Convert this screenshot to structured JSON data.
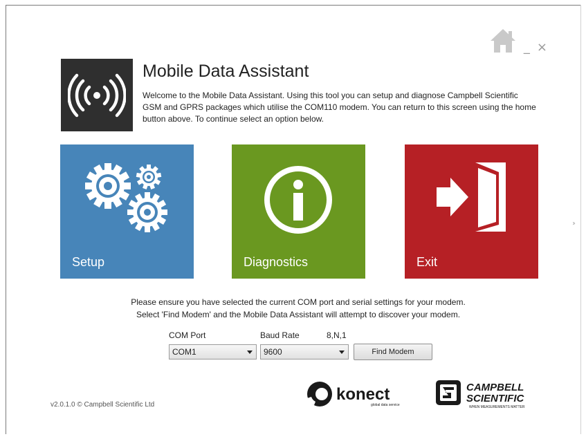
{
  "app": {
    "title": "Mobile Data Assistant",
    "welcome_text": "Welcome to the Mobile Data Assistant.  Using this tool you can setup and diagnose Campbell Scientific GSM and GPRS packages which utilise the COM110 modem.  You can return to this screen using the home button above.  To continue select an option below."
  },
  "window_controls": {
    "minimize": "_",
    "close": "×"
  },
  "tiles": [
    {
      "label": "Setup",
      "icon": "gears-icon",
      "color": "#4785b9"
    },
    {
      "label": "Diagnostics",
      "icon": "info-icon",
      "color": "#6a9820"
    },
    {
      "label": "Exit",
      "icon": "exit-door-icon",
      "color": "#b62025"
    }
  ],
  "next_arrow": "››",
  "instructions": {
    "line1": "Please ensure you have selected the current COM port and serial settings for your modem.",
    "line2": "Select 'Find Modem' and the Mobile Data Assistant will attempt to discover your modem."
  },
  "settings": {
    "com_port_label": "COM Port",
    "com_port_value": "COM1",
    "baud_rate_label": "Baud Rate",
    "baud_rate_value": "9600",
    "serial_format": "8,N,1",
    "find_button_label": "Find Modem"
  },
  "footer": {
    "version": "v2.0.1.0 © Campbell Scientific Ltd",
    "konect_name": "konect",
    "konect_tagline": "global data service",
    "campbell_line1": "CAMPBELL",
    "campbell_line2": "SCIENTIFIC",
    "campbell_tagline": "WHEN MEASUREMENTS MATTER"
  }
}
